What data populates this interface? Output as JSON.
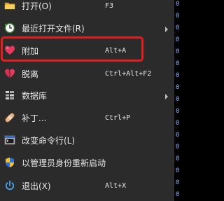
{
  "colors": {
    "menu_background": "#2b2b2b",
    "text": "#e8e8e8",
    "highlight_border": "#e11f1f"
  },
  "menu": {
    "items": [
      {
        "icon": "folder-icon",
        "label": "打开(O)",
        "shortcut": "F3",
        "submenu": false
      },
      {
        "icon": "clock-icon",
        "label": "最近打开文件(R)",
        "shortcut": "",
        "submenu": true
      },
      {
        "icon": "heart-icon",
        "label": "附加",
        "shortcut": "Alt+A",
        "submenu": false,
        "highlighted": true
      },
      {
        "icon": "broken-heart-icon",
        "label": "脱离",
        "shortcut": "Ctrl+Alt+F2",
        "submenu": false
      },
      {
        "icon": "database-icon",
        "label": "数据库",
        "shortcut": "",
        "submenu": true
      },
      {
        "icon": "bandage-icon",
        "label": "补丁...",
        "shortcut": "Ctrl+P",
        "submenu": false
      },
      {
        "icon": "command-line-icon",
        "label": "改变命令行(L)",
        "shortcut": "",
        "submenu": false
      },
      {
        "icon": "shield-icon",
        "label": "以管理员身份重新启动",
        "shortcut": "",
        "submenu": false
      },
      {
        "icon": "power-icon",
        "label": "退出(X)",
        "shortcut": "Alt+X",
        "submenu": false
      }
    ]
  },
  "background_column": {
    "glyphs": [
      "0",
      "0",
      "0",
      "0",
      "0",
      "0",
      "0",
      "0",
      "0",
      "0",
      "0",
      "0",
      "0",
      "0",
      "0",
      "0",
      "0"
    ]
  }
}
